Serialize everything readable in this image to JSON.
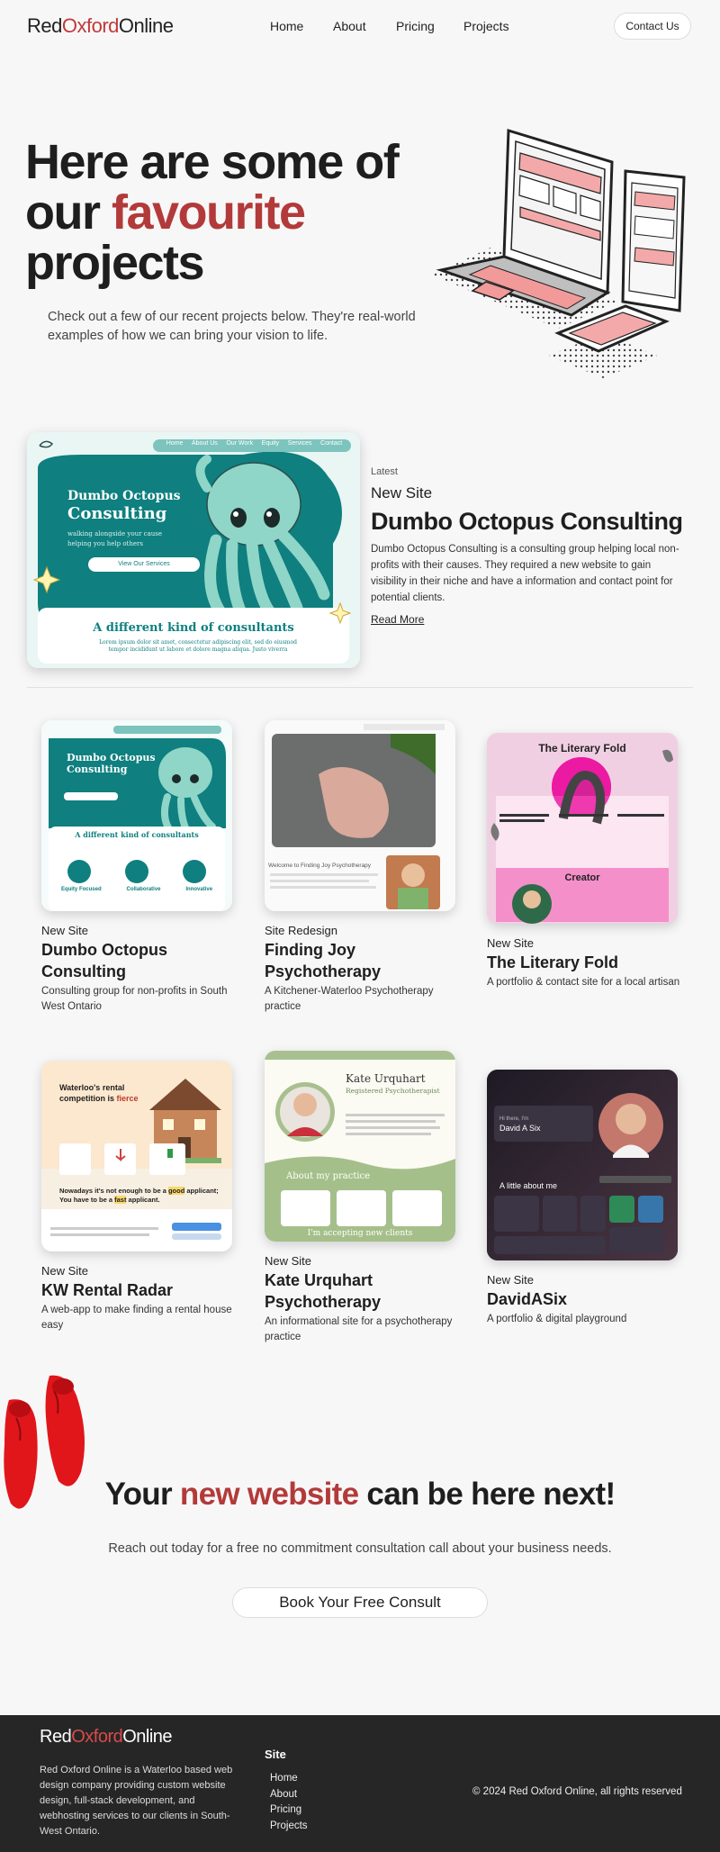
{
  "header": {
    "logo_part1": "Red",
    "logo_part2": "Oxford",
    "logo_part3": "Online",
    "nav": [
      "Home",
      "About",
      "Pricing",
      "Projects"
    ],
    "contact": "Contact Us"
  },
  "hero": {
    "title_line1": "Here are some of",
    "title_line2a": "our ",
    "title_line2b": "favourite",
    "title_line3": "projects",
    "subtitle": "Check out a few of our recent projects below. They're real-world examples of how we can bring your vision to life."
  },
  "featured": {
    "latest": "Latest",
    "kicker": "New Site",
    "title": "Dumbo Octopus Consulting",
    "description": "Dumbo Octopus Consulting is a consulting group helping local non-profits with their causes. They required a new website to gain visibility in their niche and have a information and contact point for potential clients.",
    "read_more": "Read More",
    "shot": {
      "nav": [
        "Home",
        "About Us",
        "Our Work",
        "Equity",
        "Services",
        "Contact"
      ],
      "brand_line1": "Dumbo Octopus",
      "brand_line2": "Consulting",
      "tagline": "walking alongside your cause helping you help others",
      "button": "View Our Services",
      "heading": "A different kind of consultants",
      "lorem": "Lorem ipsum dolor sit amet, consectetur adipiscing elit, sed do eiusmod tempor incididunt ut labore et dolore magna aliqua. Justo viverra aliquet"
    }
  },
  "cards": [
    {
      "kicker": "New Site",
      "title": "Dumbo Octopus Consulting",
      "desc": "Consulting group for non-profits in South West Ontario"
    },
    {
      "kicker": "Site Redesign",
      "title": "Finding Joy Psychotherapy",
      "desc": "A Kitchener-Waterloo Psychotherapy practice"
    },
    {
      "kicker": "New Site",
      "title": "The Literary Fold",
      "desc": "A portfolio & contact site for a local artisan"
    },
    {
      "kicker": "New Site",
      "title": "KW Rental Radar",
      "desc": "A web-app to make finding a rental house easy"
    },
    {
      "kicker": "New Site",
      "title": "Kate Urquhart Psychotherapy",
      "desc": "An informational site for a psychotherapy practice"
    },
    {
      "kicker": "New Site",
      "title": "DavidASix",
      "desc": "A portfolio & digital playground"
    }
  ],
  "thumbs": {
    "t1_heading": "A different kind of consultants",
    "t1_cols": [
      "Equity Focused",
      "Collaborative",
      "Innovative"
    ],
    "t2_welcome": "Welcome to Finding Joy Psychotherapy",
    "t3_title": "The Literary Fold",
    "t3_creator": "Creator",
    "t4_title_a": "Waterloo's rental",
    "t4_title_b": "competition is ",
    "t4_title_c": "fierce",
    "t4_footer_a": "Nowadays it's not enough to be a ",
    "t4_footer_b": "good",
    "t4_footer_c": " applicant;",
    "t4_footer_d": "You have to be a ",
    "t4_footer_e": "fast",
    "t4_footer_f": " applicant.",
    "t5_name": "Kate Urquhart",
    "t5_role": "Registered Psychotherapist",
    "t5_practice": "About my practice",
    "t5_accepting": "I'm accepting new clients",
    "t6_hi": "Hi there, I'm",
    "t6_name": "David A Six",
    "t6_about": "A little about me"
  },
  "cta": {
    "title_a": "Your ",
    "title_b": "new website",
    "title_c": " can be here next!",
    "subtitle": "Reach out today for a free no commitment consultation call about your business needs.",
    "button": "Book Your Free Consult"
  },
  "footer": {
    "logo_part1": "Red",
    "logo_part2": "Oxford",
    "logo_part3": "Online",
    "description": "Red Oxford Online is a Waterloo based web design company providing custom website design, full-stack development, and webhosting services to our clients in South-West Ontario.",
    "site_heading": "Site",
    "links": [
      "Home",
      "About",
      "Pricing",
      "Projects"
    ],
    "copyright": "© 2024 Red Oxford Online, all rights reserved"
  },
  "colors": {
    "accent": "#b33a3a",
    "teal": "#0f7f7f",
    "footer_bg": "#262626"
  }
}
